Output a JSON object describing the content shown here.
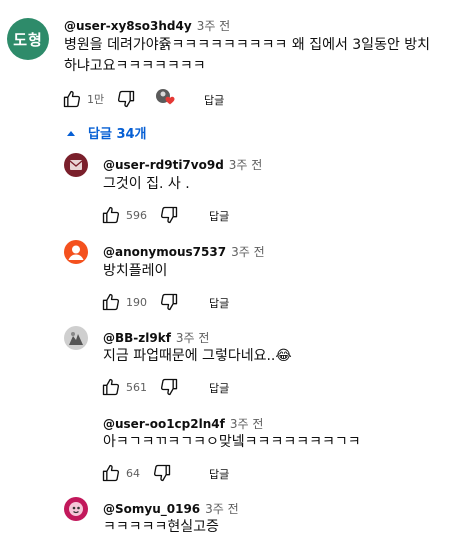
{
  "comment": {
    "avatar_text": "도형",
    "handle": "@user-xy8so3hd4y",
    "time": "3주 전",
    "text_line1": "병원을 데려가야쥵ㅋㅋㅋㅋㅋㅋㅋㅋㅋ 왜 집에서 3일동안 방치",
    "text_line2": "하냐고요ㅋㅋㅋㅋㅋㅋㅋ",
    "likes": "1만",
    "reply_label": "답글"
  },
  "replies_toggle": {
    "label": "답글 34개",
    "icon": "chevron-up-icon"
  },
  "replies": [
    {
      "handle": "@user-rd9ti7vo9d",
      "time": "3주 전",
      "text": "그것이 집. 사 .",
      "likes": "596",
      "reply_label": "답글",
      "avatar_color": "#7a1f2b"
    },
    {
      "handle": "@anonymous7537",
      "time": "3주 전",
      "text": "방치플레이",
      "likes": "190",
      "reply_label": "답글",
      "avatar_color": "#f4511e"
    },
    {
      "handle": "@BB-zl9kf",
      "time": "3주 전",
      "text": "지금 파업때문에 그렇다네요..😂",
      "likes": "561",
      "reply_label": "답글",
      "avatar_color": "#b0b0b0"
    },
    {
      "handle": "@user-oo1cp2ln4f",
      "time": "3주 전",
      "text": "아ㅋㄱㅋㄲㅋㄱㅋㅇ맞넼ㅋㅋㅋㅋㅋㅋㅋㄱㅋ",
      "likes": "64",
      "reply_label": "답글",
      "avatar_color": "#ffffff"
    },
    {
      "handle": "@Somyu_0196",
      "time": "3주 전",
      "text": "ㅋㅋㅋㅋㅋ현실고증",
      "avatar_color": "#c2185b"
    }
  ],
  "colors": {
    "link": "#065fd4",
    "text": "#0f0f0f",
    "muted": "#606060",
    "heart": "#e53935"
  }
}
